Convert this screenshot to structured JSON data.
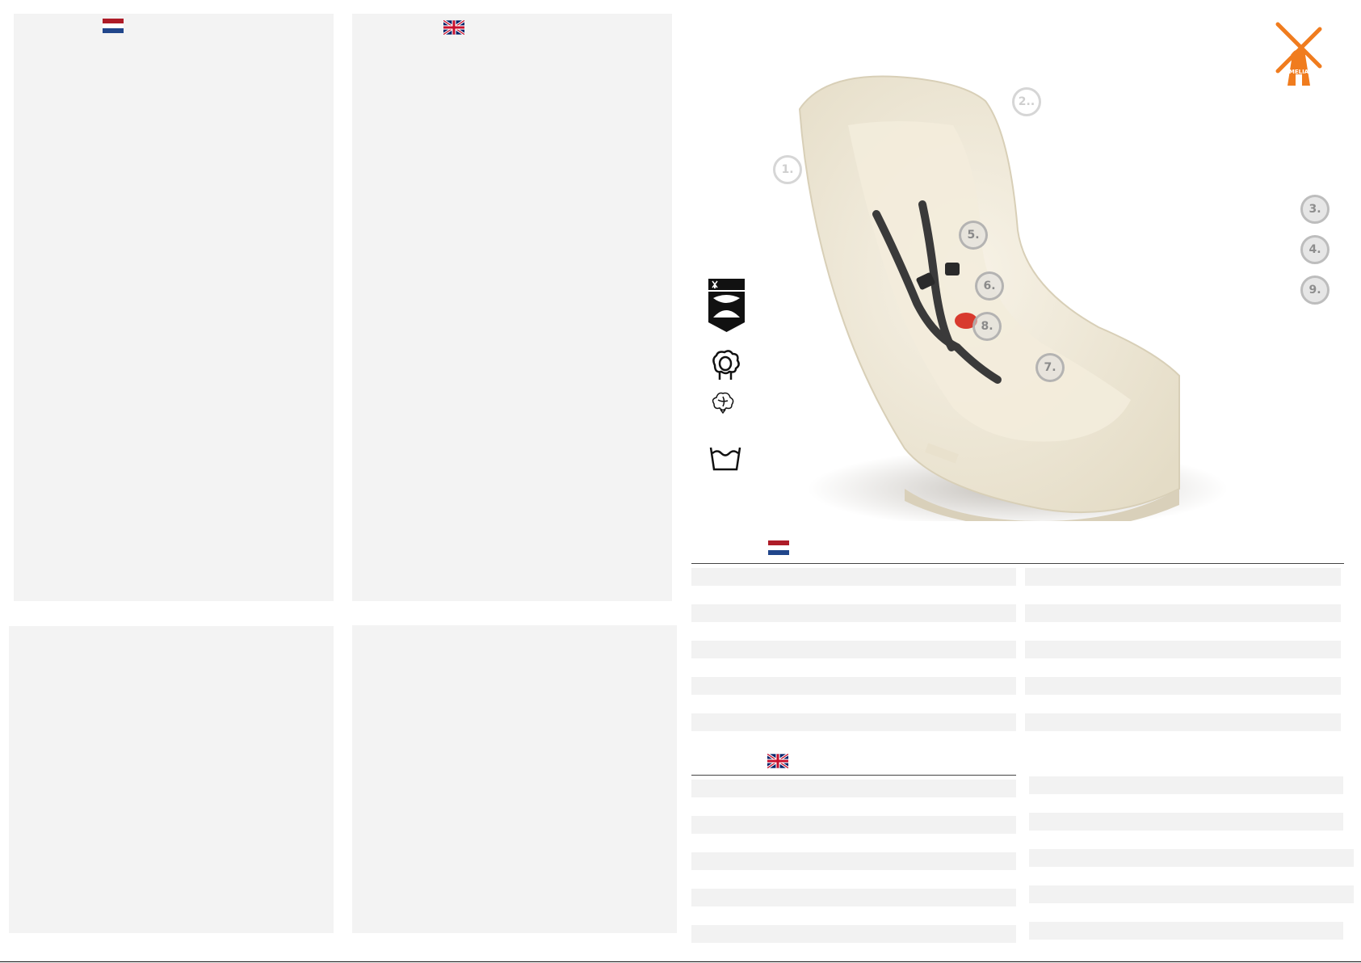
{
  "colors": {
    "panel_bg": "#f3f3f3",
    "brand_orange": "#f07c1e",
    "seat_fleece": "#efe9da",
    "harness": "#3a3a3a",
    "buckle_red": "#d83a2e"
  },
  "flags": {
    "top_left": "netherlands-flag",
    "top_middle": "united-kingdom-flag",
    "table_nl": "netherlands-flag",
    "table_en": "united-kingdom-flag"
  },
  "logo": {
    "text": "MELIA",
    "icon": "windmill-icon"
  },
  "product": {
    "callouts": [
      "1.",
      "2..",
      "5.",
      "6.",
      "8.",
      "7."
    ],
    "side_callouts": [
      "3.",
      "4.",
      "9."
    ]
  },
  "care_icons": [
    "melia-shield-icon",
    "sheep-wool-icon",
    "cotton-icon",
    "wash-tub-icon"
  ]
}
